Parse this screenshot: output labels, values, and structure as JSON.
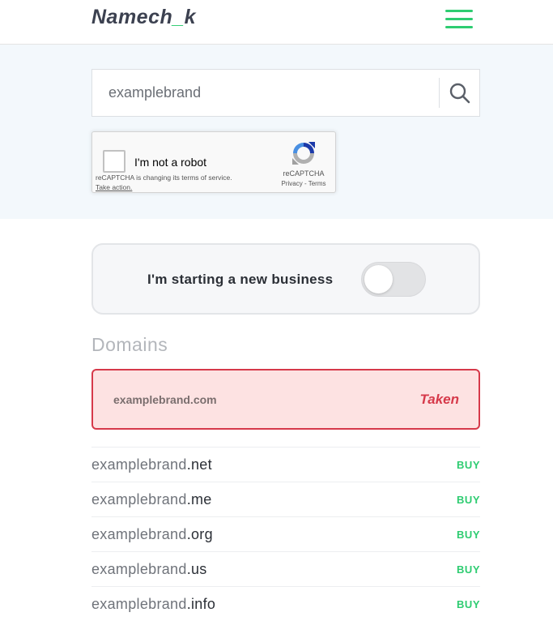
{
  "header": {
    "logo_main": "Namech",
    "logo_underscore": "_",
    "logo_end": "k"
  },
  "search": {
    "value": "examplebrand",
    "placeholder": ""
  },
  "captcha": {
    "label": "I'm not a robot",
    "notice": "reCAPTCHA is changing its terms of service.",
    "notice_link": "Take action.",
    "brand": "reCAPTCHA",
    "terms": "Privacy - Terms"
  },
  "business_toggle": {
    "label": "I'm starting a new business",
    "checked": false
  },
  "domains": {
    "title": "Domains",
    "taken": {
      "domain": "examplebrand.com",
      "status": "Taken"
    },
    "items": [
      {
        "base": "examplebrand",
        "tld": ".net",
        "action": "BUY"
      },
      {
        "base": "examplebrand",
        "tld": ".me",
        "action": "BUY"
      },
      {
        "base": "examplebrand",
        "tld": ".org",
        "action": "BUY"
      },
      {
        "base": "examplebrand",
        "tld": ".us",
        "action": "BUY"
      },
      {
        "base": "examplebrand",
        "tld": ".info",
        "action": "BUY"
      }
    ]
  },
  "colors": {
    "accent": "#2ecc71",
    "taken_red": "#d6394a",
    "taken_bg": "#fde2e2",
    "search_bg": "#f3f8fc"
  },
  "icons": {
    "menu": "hamburger-menu-icon",
    "search": "search-icon",
    "captcha": "recaptcha-logo-icon"
  }
}
